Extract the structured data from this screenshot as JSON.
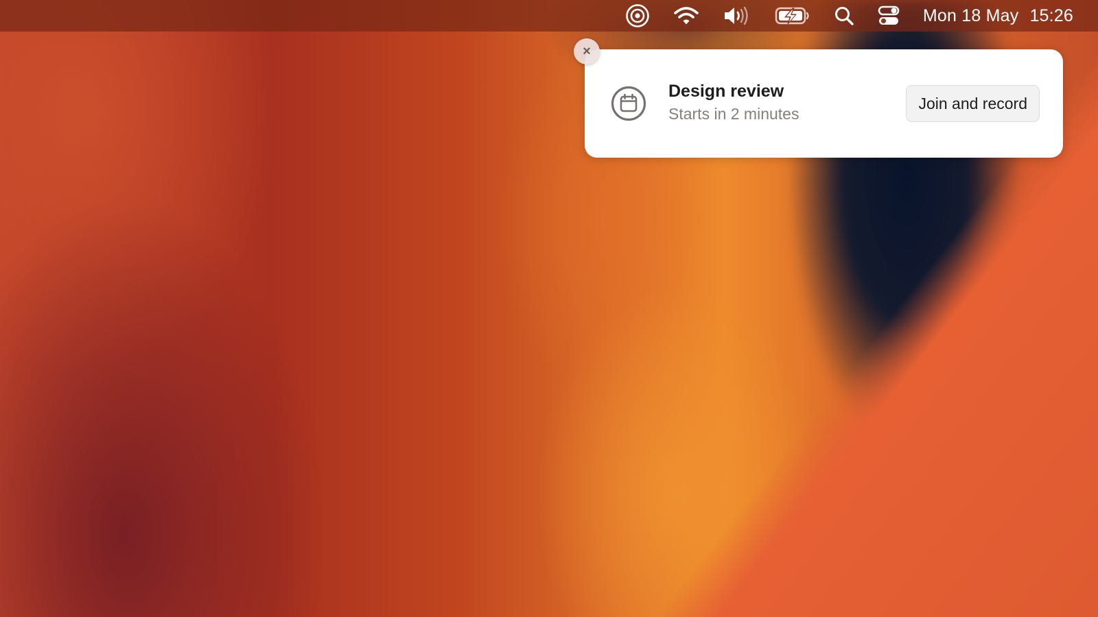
{
  "menubar": {
    "status_icons": [
      "focus-target-icon",
      "wifi-icon",
      "volume-icon",
      "battery-charging-icon",
      "search-icon",
      "control-center-icon"
    ],
    "date": "Mon 18 May",
    "time": "15:26"
  },
  "notification": {
    "close_glyph": "×",
    "app_icon": "calendar-icon",
    "title": "Design review",
    "subtitle": "Starts in 2 minutes",
    "action_label": "Join and record"
  },
  "colors": {
    "wallpaper_primary": "#c1461f",
    "wallpaper_accent": "#ee8a2c",
    "wallpaper_dark": "#0a162e",
    "notification_bg": "#ffffff"
  }
}
